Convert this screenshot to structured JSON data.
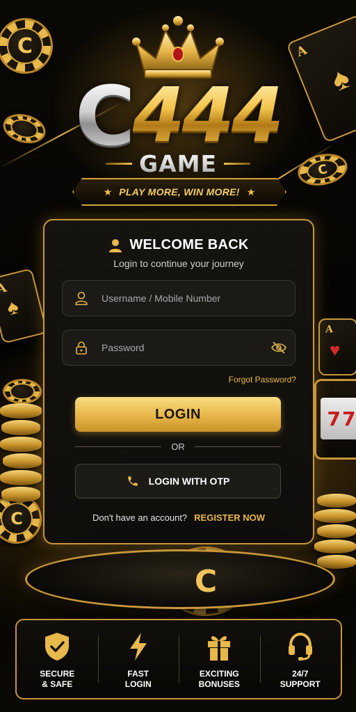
{
  "brand": {
    "logo_prefix": "C",
    "logo_number": "444",
    "logo_sub": "GAME",
    "tagline": "PLAY MORE, WIN MORE!",
    "chip_letter": "C",
    "card_rank": "A"
  },
  "login_form": {
    "title": "WELCOME BACK",
    "subtitle": "Login to continue your journey",
    "username_placeholder": "Username / Mobile Number",
    "password_placeholder": "Password",
    "forgot_password": "Forgot Password?",
    "login_button": "LOGIN",
    "divider_text": "OR",
    "otp_button": "LOGIN WITH OTP",
    "no_account_text": "Don't have an account?",
    "register_link": "REGISTER NOW"
  },
  "features": [
    {
      "label": "SECURE\n& SAFE",
      "icon": "shield-check-icon"
    },
    {
      "label": "FAST\nLOGIN",
      "icon": "lightning-icon"
    },
    {
      "label": "EXCITING\nBONUSES",
      "icon": "gift-icon"
    },
    {
      "label": "24/7\nSUPPORT",
      "icon": "headset-icon"
    }
  ],
  "colors": {
    "gold": "#e7b84a",
    "gold_border": "#c9973a",
    "background": "#000000",
    "panel": "#161410"
  }
}
